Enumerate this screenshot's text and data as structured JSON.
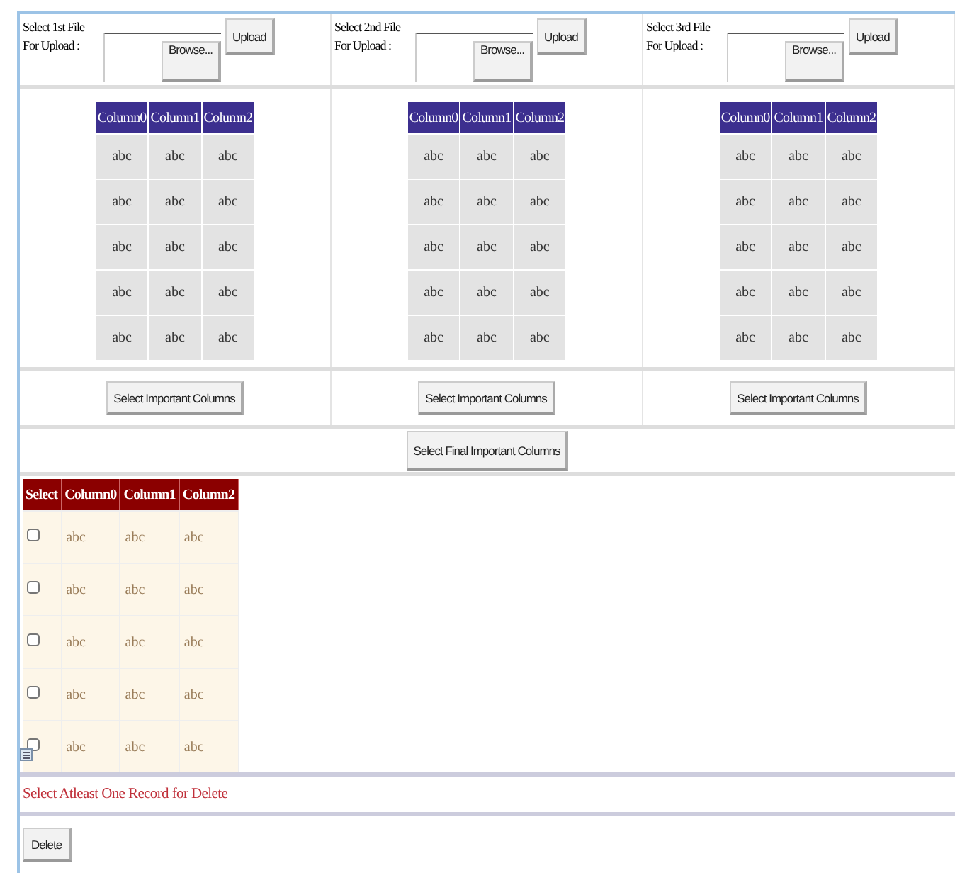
{
  "uploads": [
    {
      "label": "Select 1st File For Upload :",
      "browse": "Browse...",
      "upload": "Upload"
    },
    {
      "label": "Select 2nd File For Upload :",
      "browse": "Browse...",
      "upload": "Upload"
    },
    {
      "label": "Select 3rd File For Upload :",
      "browse": "Browse...",
      "upload": "Upload"
    }
  ],
  "source_grids": [
    {
      "columns": [
        "Column0",
        "Column1",
        "Column2"
      ],
      "rows": [
        [
          "abc",
          "abc",
          "abc"
        ],
        [
          "abc",
          "abc",
          "abc"
        ],
        [
          "abc",
          "abc",
          "abc"
        ],
        [
          "abc",
          "abc",
          "abc"
        ],
        [
          "abc",
          "abc",
          "abc"
        ]
      ],
      "button": "Select Important Columns"
    },
    {
      "columns": [
        "Column0",
        "Column1",
        "Column2"
      ],
      "rows": [
        [
          "abc",
          "abc",
          "abc"
        ],
        [
          "abc",
          "abc",
          "abc"
        ],
        [
          "abc",
          "abc",
          "abc"
        ],
        [
          "abc",
          "abc",
          "abc"
        ],
        [
          "abc",
          "abc",
          "abc"
        ]
      ],
      "button": "Select Important Columns"
    },
    {
      "columns": [
        "Column0",
        "Column1",
        "Column2"
      ],
      "rows": [
        [
          "abc",
          "abc",
          "abc"
        ],
        [
          "abc",
          "abc",
          "abc"
        ],
        [
          "abc",
          "abc",
          "abc"
        ],
        [
          "abc",
          "abc",
          "abc"
        ],
        [
          "abc",
          "abc",
          "abc"
        ]
      ],
      "button": "Select Important Columns"
    }
  ],
  "final_button": "Select Final Important Columns",
  "result_grid": {
    "select_header": "Select",
    "columns": [
      "Column0",
      "Column1",
      "Column2"
    ],
    "rows": [
      {
        "checked": false,
        "cells": [
          "abc",
          "abc",
          "abc"
        ]
      },
      {
        "checked": false,
        "cells": [
          "abc",
          "abc",
          "abc"
        ]
      },
      {
        "checked": false,
        "cells": [
          "abc",
          "abc",
          "abc"
        ]
      },
      {
        "checked": false,
        "cells": [
          "abc",
          "abc",
          "abc"
        ]
      },
      {
        "checked": false,
        "cells": [
          "abc",
          "abc",
          "abc"
        ]
      }
    ]
  },
  "message": "Select Atleast One Record for Delete",
  "delete_button": "Delete"
}
